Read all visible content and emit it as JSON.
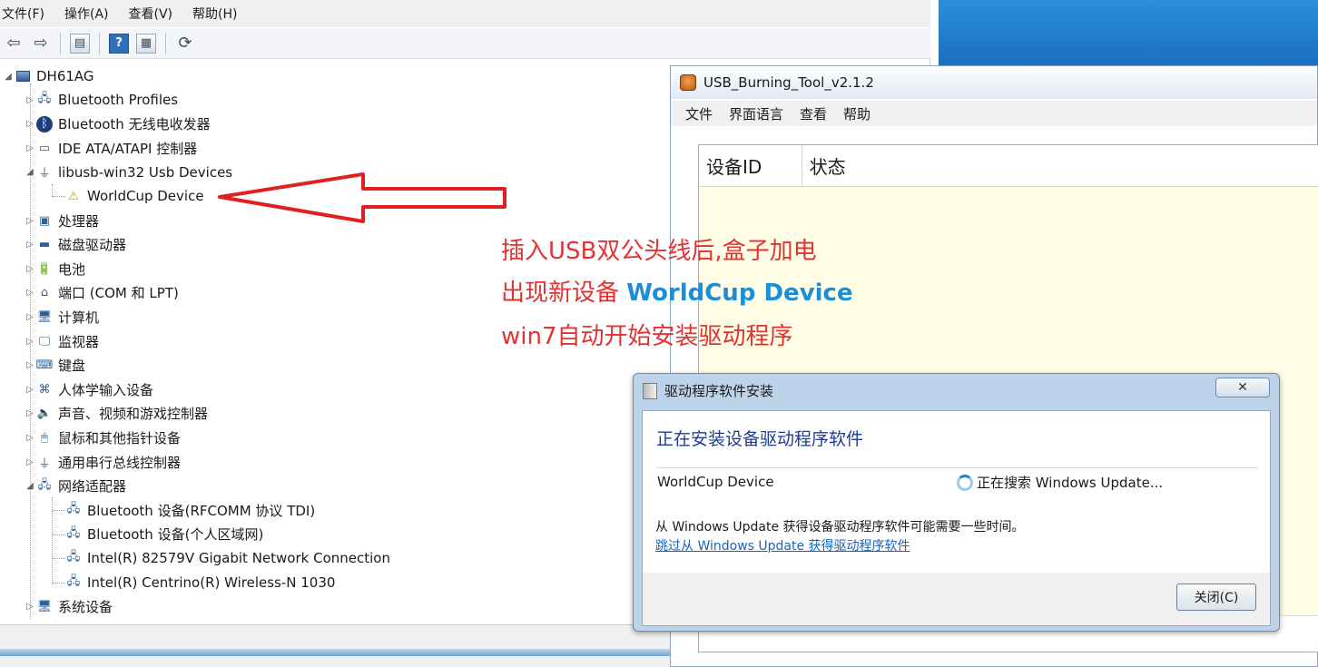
{
  "devmgr": {
    "menu": [
      "文件(F)",
      "操作(A)",
      "查看(V)",
      "帮助(H)"
    ],
    "toolbar": {
      "back_icon": "back-arrow-icon",
      "forward_icon": "forward-arrow-icon",
      "help_label": "?"
    },
    "root": "DH61AG",
    "tree": [
      {
        "label": "Bluetooth Profiles",
        "icon": "network-adapter-icon",
        "expanded": false
      },
      {
        "label": "Bluetooth 无线电收发器",
        "icon": "bluetooth-icon",
        "expanded": false
      },
      {
        "label": "IDE ATA/ATAPI 控制器",
        "icon": "ide-controller-icon",
        "expanded": false
      },
      {
        "label": "libusb-win32 Usb Devices",
        "icon": "usb-plug-icon",
        "expanded": true
      },
      {
        "label": "WorldCup Device",
        "icon": "device-warning-icon",
        "child": true
      },
      {
        "label": "处理器",
        "icon": "processor-icon",
        "expanded": false
      },
      {
        "label": "磁盘驱动器",
        "icon": "disk-drive-icon",
        "expanded": false
      },
      {
        "label": "电池",
        "icon": "battery-icon",
        "expanded": false
      },
      {
        "label": "端口 (COM 和 LPT)",
        "icon": "port-icon",
        "expanded": false
      },
      {
        "label": "计算机",
        "icon": "computer-icon",
        "expanded": false
      },
      {
        "label": "监视器",
        "icon": "monitor-icon",
        "expanded": false
      },
      {
        "label": "键盘",
        "icon": "keyboard-icon",
        "expanded": false
      },
      {
        "label": "人体学输入设备",
        "icon": "hid-icon",
        "expanded": false
      },
      {
        "label": "声音、视频和游戏控制器",
        "icon": "speaker-icon",
        "expanded": false
      },
      {
        "label": "鼠标和其他指针设备",
        "icon": "mouse-icon",
        "expanded": false
      },
      {
        "label": "通用串行总线控制器",
        "icon": "usb-plug-icon",
        "expanded": false
      },
      {
        "label": "网络适配器",
        "icon": "network-adapter-icon",
        "expanded": true
      },
      {
        "label": "Bluetooth 设备(RFCOMM 协议 TDI)",
        "icon": "network-adapter-icon",
        "child": true
      },
      {
        "label": "Bluetooth 设备(个人区域网)",
        "icon": "network-adapter-icon",
        "child": true
      },
      {
        "label": "Intel(R) 82579V Gigabit Network Connection",
        "icon": "network-adapter-icon",
        "child": true
      },
      {
        "label": "Intel(R) Centrino(R) Wireless-N 1030",
        "icon": "network-adapter-icon",
        "child": true
      },
      {
        "label": "系统设备",
        "icon": "system-device-icon",
        "expanded": false
      }
    ]
  },
  "usbtool": {
    "title": "USB_Burning_Tool_v2.1.2",
    "menu": [
      "文件",
      "界面语言",
      "查看",
      "帮助"
    ],
    "columns": [
      "设备ID",
      "状态"
    ],
    "list_bg": "#fffde6"
  },
  "annotation": {
    "line1": "插入USB双公头线后,盒子加电",
    "line2_prefix": "出现新设备 ",
    "line2_highlight": "WorldCup Device",
    "line3": "win7自动开始安装驱动程序",
    "color": "#e23232",
    "highlight_color": "#1a8fd8"
  },
  "dialog": {
    "title": "驱动程序软件安装",
    "close_glyph": "✕",
    "heading": "正在安装设备驱动程序软件",
    "device": "WorldCup Device",
    "status": "正在搜索 Windows Update...",
    "info": "从 Windows Update 获得设备驱动程序软件可能需要一些时间。",
    "link": "跳过从 Windows Update 获得驱动程序软件",
    "button": "关闭(C)"
  }
}
